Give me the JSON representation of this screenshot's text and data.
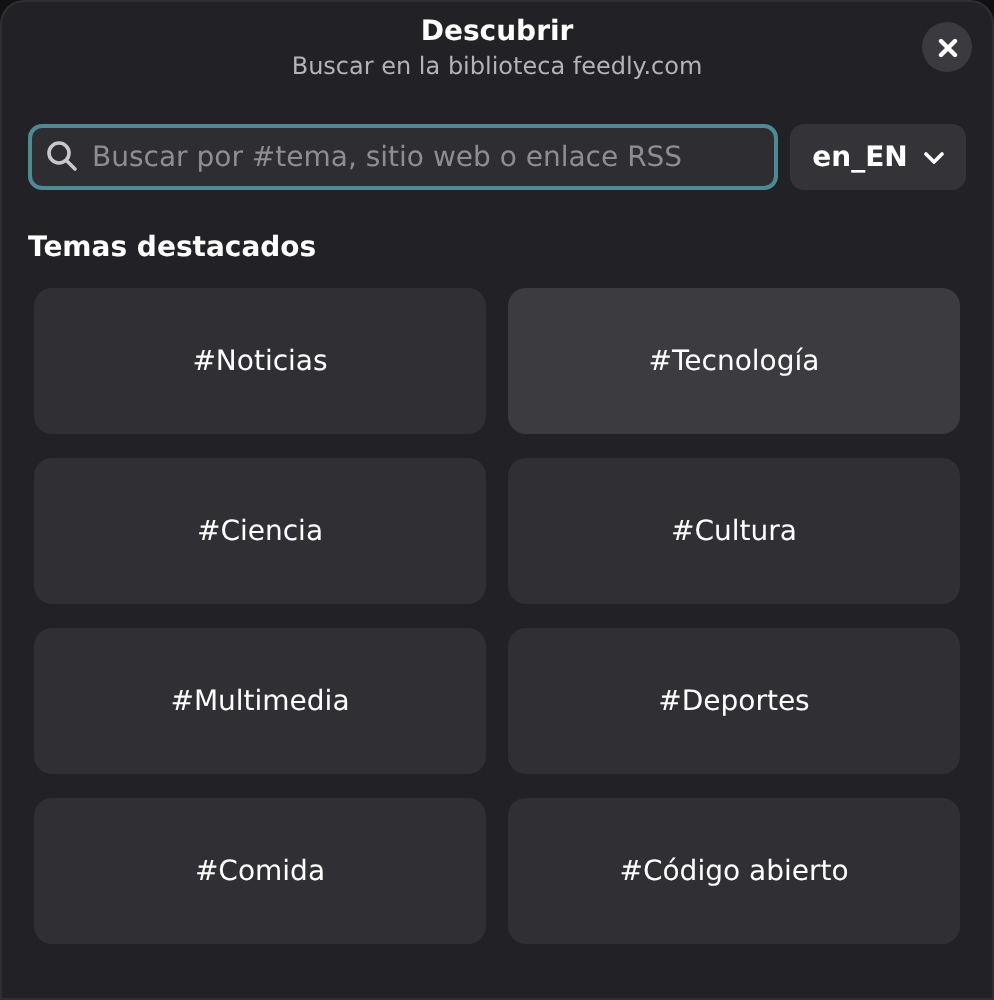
{
  "header": {
    "title": "Descubrir",
    "subtitle": "Buscar en la biblioteca feedly.com"
  },
  "search": {
    "placeholder": "Buscar por #tema, sitio web o enlace RSS",
    "language": "en_EN"
  },
  "section_title": "Temas destacados",
  "topics": [
    {
      "label": "#Noticias",
      "hovered": false
    },
    {
      "label": "#Tecnología",
      "hovered": true
    },
    {
      "label": "#Ciencia",
      "hovered": false
    },
    {
      "label": "#Cultura",
      "hovered": false
    },
    {
      "label": "#Multimedia",
      "hovered": false
    },
    {
      "label": "#Deportes",
      "hovered": false
    },
    {
      "label": "#Comida",
      "hovered": false
    },
    {
      "label": "#Código abierto",
      "hovered": false
    }
  ]
}
